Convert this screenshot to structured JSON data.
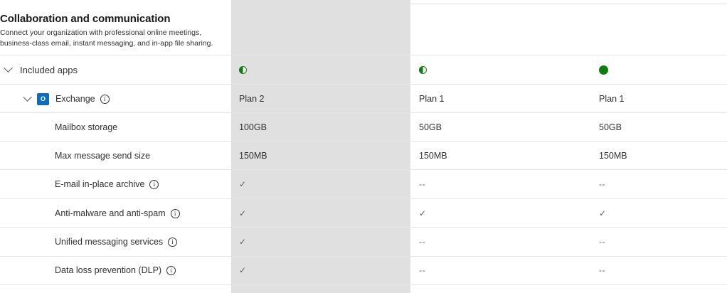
{
  "section": {
    "title": "Collaboration and communication",
    "description": "Connect your organization with professional online meetings, business-class email, instant messaging, and in-app file sharing."
  },
  "included_apps": {
    "label": "Included apps",
    "plans": [
      "half",
      "half",
      "full"
    ]
  },
  "exchange": {
    "label": "Exchange",
    "icon_text": "O",
    "plans": [
      "Plan 2",
      "Plan 1",
      "Plan 1"
    ]
  },
  "features": [
    {
      "label": "Mailbox storage",
      "info": false,
      "values": [
        "100GB",
        "50GB",
        "50GB"
      ]
    },
    {
      "label": "Max message send size",
      "info": false,
      "values": [
        "150MB",
        "150MB",
        "150MB"
      ]
    },
    {
      "label": "E-mail in-place archive",
      "info": true,
      "values": [
        "✓",
        "--",
        "--"
      ]
    },
    {
      "label": "Anti-malware and anti-spam",
      "info": true,
      "values": [
        "✓",
        "✓",
        "✓"
      ]
    },
    {
      "label": "Unified messaging services",
      "info": true,
      "values": [
        "✓",
        "--",
        "--"
      ]
    },
    {
      "label": "Data loss prevention (DLP)",
      "info": true,
      "values": [
        "✓",
        "--",
        "--"
      ]
    }
  ],
  "colors": {
    "highlight_column": "#e0e0e0",
    "status_green": "#107c10",
    "exchange_blue": "#0f6cbd"
  },
  "icons": {
    "expand": "chevron-down-icon",
    "info": "info-icon",
    "partial": "half-circle-icon",
    "complete": "filled-circle-icon",
    "included": "checkmark-icon"
  }
}
